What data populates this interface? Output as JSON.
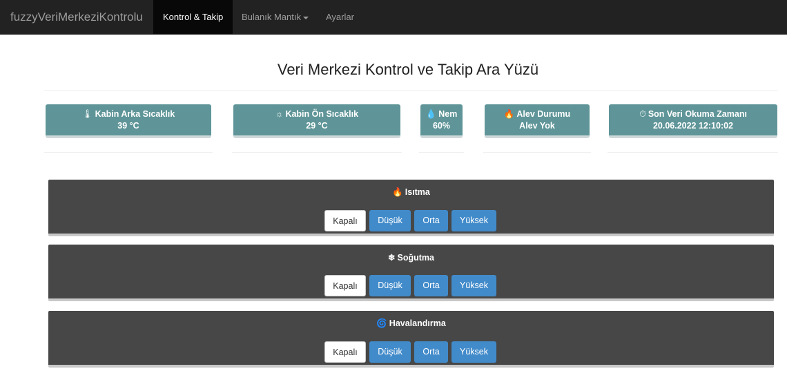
{
  "navbar": {
    "brand": "fuzzyVeriMerkeziKontrolu",
    "items": [
      {
        "label": "Kontrol & Takip"
      },
      {
        "label": "Bulanık Mantık"
      },
      {
        "label": "Ayarlar"
      }
    ]
  },
  "page": {
    "title": "Veri Merkezi Kontrol ve Takip Ara Yüzü"
  },
  "cards": [
    {
      "icon": "thermometer-icon",
      "glyph": "🌡",
      "label": "Kabin Arka Sıcaklık",
      "value": "39 °C"
    },
    {
      "icon": "sun-icon",
      "glyph": "☼",
      "label": "Kabin Ön Sıcaklık",
      "value": "29 °C"
    },
    {
      "icon": "droplet-icon",
      "glyph": "💧",
      "label": "Nem",
      "value": "60%"
    },
    {
      "icon": "fire-icon",
      "glyph": "🔥",
      "label": "Alev Durumu",
      "value": "Alev Yok"
    },
    {
      "icon": "clock-icon",
      "glyph": "⏱",
      "label": "Son Veri Okuma Zamanı",
      "value": "20.06.2022 12:10:02"
    }
  ],
  "panels": [
    {
      "icon": "fire-icon",
      "glyph": "🔥",
      "title": "Isıtma",
      "buttons": [
        "Kapalı",
        "Düşük",
        "Orta",
        "Yüksek"
      ],
      "selected": "Kapalı"
    },
    {
      "icon": "snowflake-icon",
      "glyph": "❄",
      "title": "Soğutma",
      "buttons": [
        "Kapalı",
        "Düşük",
        "Orta",
        "Yüksek"
      ],
      "selected": "Kapalı"
    },
    {
      "icon": "fan-icon",
      "glyph": "🌀",
      "title": "Havalandırma",
      "buttons": [
        "Kapalı",
        "Düşük",
        "Orta",
        "Yüksek"
      ],
      "selected": "Kapalı"
    }
  ],
  "colors": {
    "navbar": "#222222",
    "card": "#5f9598",
    "panel": "#474747",
    "button_active": "#428bca"
  }
}
